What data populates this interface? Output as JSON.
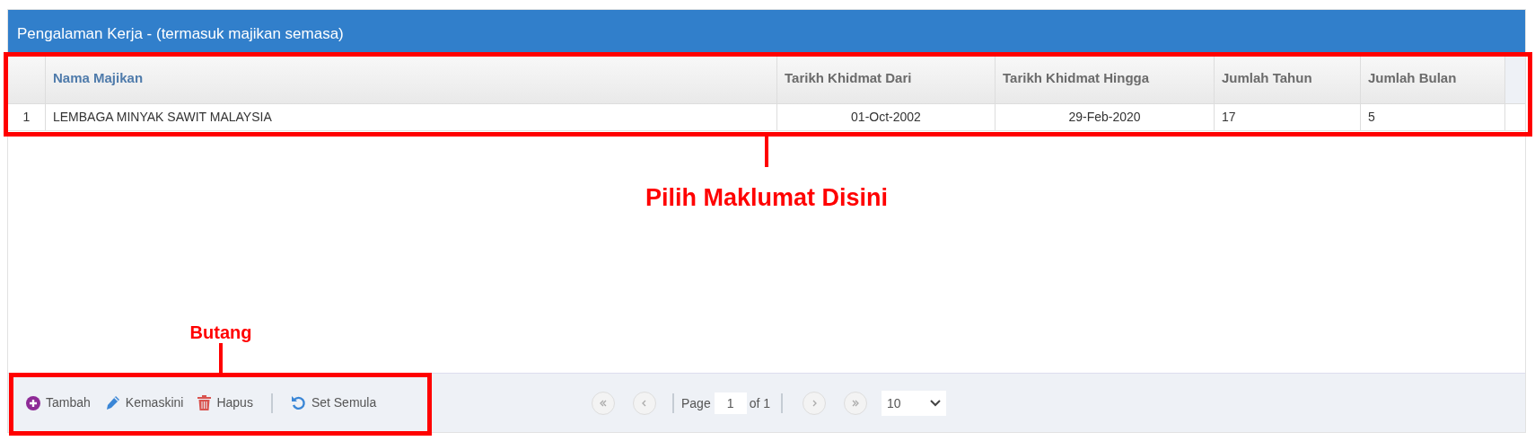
{
  "panel": {
    "title": "Pengalaman Kerja - (termasuk majikan semasa)"
  },
  "table": {
    "columns": [
      {
        "label": "Nama Majikan",
        "kind": "text",
        "sorted": true
      },
      {
        "label": "Tarikh Khidmat Dari",
        "kind": "date",
        "sorted": false
      },
      {
        "label": "Tarikh Khidmat Hingga",
        "kind": "date",
        "sorted": false
      },
      {
        "label": "Jumlah Tahun",
        "kind": "text",
        "sorted": false
      },
      {
        "label": "Jumlah Bulan",
        "kind": "text",
        "sorted": false
      }
    ],
    "rows": [
      {
        "number": "1",
        "cells": [
          "LEMBAGA MINYAK SAWIT MALAYSIA",
          "01-Oct-2002",
          "29-Feb-2020",
          "17",
          "5"
        ]
      }
    ]
  },
  "toolbar": {
    "buttons": [
      {
        "label": "Tambah",
        "kind": "add"
      },
      {
        "label": "Kemaskini",
        "kind": "edit"
      },
      {
        "label": "Hapus",
        "kind": "delete"
      },
      {
        "label": "Set Semula",
        "kind": "reset"
      }
    ]
  },
  "pager": {
    "page_label": "Page",
    "page": "1",
    "of_label": "of 1",
    "page_size": "10"
  },
  "annotations": [
    {
      "label": "Pilih Maklumat Disini",
      "kind": "table"
    },
    {
      "label": "Butang",
      "kind": "buttons"
    }
  ]
}
